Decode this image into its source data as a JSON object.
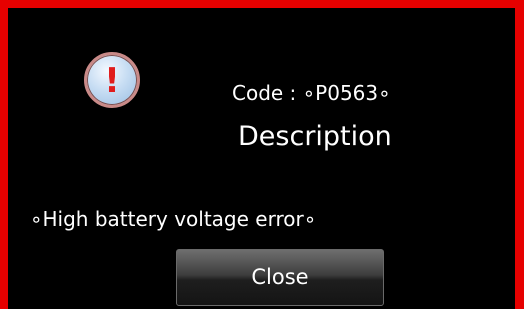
{
  "dialog": {
    "icon": "exclamation-icon",
    "code_text": "Code : ∘P0563∘",
    "title": "Description",
    "message": "∘High battery voltage error∘",
    "close_label": "Close",
    "border_color": "#e60000",
    "background_color": "#000000"
  }
}
